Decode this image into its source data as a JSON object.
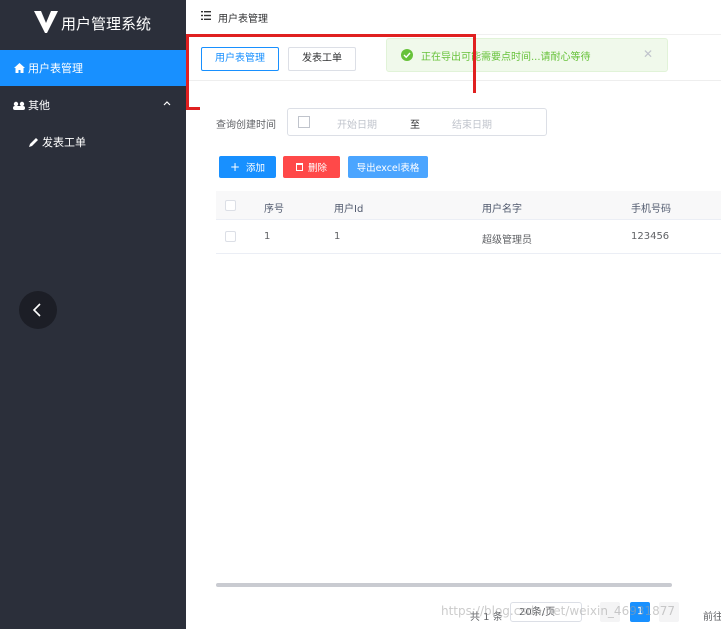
{
  "app": {
    "title": "用户管理系统"
  },
  "sidebar": {
    "items": [
      {
        "label": "用户表管理",
        "icon": "home-icon",
        "active": true
      },
      {
        "label": "其他",
        "icon": "group-icon",
        "expanded": true
      },
      {
        "label": "发表工单",
        "icon": "pencil-icon"
      }
    ]
  },
  "header": {
    "breadcrumb": "用户表管理"
  },
  "tabs": [
    {
      "label": "用户表管理",
      "active": true
    },
    {
      "label": "发表工单",
      "active": false
    }
  ],
  "toast": {
    "text": "正在导出可能需要点时间...请耐心等待",
    "type": "success"
  },
  "query": {
    "label": "查询创建时间",
    "start_placeholder": "开始日期",
    "separator": "至",
    "end_placeholder": "结束日期"
  },
  "actions": {
    "add": "添加",
    "delete": "删除",
    "export": "导出excel表格"
  },
  "table": {
    "columns": [
      "序号",
      "用户Id",
      "用户名字",
      "手机号码"
    ],
    "rows": [
      [
        "1",
        "1",
        "超级管理员",
        "123456"
      ]
    ]
  },
  "pagination": {
    "total_text": "共 1 条",
    "page_size": "20条/页",
    "current_page": "1",
    "jump_text": "前往"
  },
  "watermark": "https://blog.csdn.net/weixin_46931877",
  "colors": {
    "primary": "#1890ff",
    "danger": "#ff4949",
    "success": "#67c23a",
    "sidebar": "#2b2f3a",
    "highlight": "#e02020"
  }
}
